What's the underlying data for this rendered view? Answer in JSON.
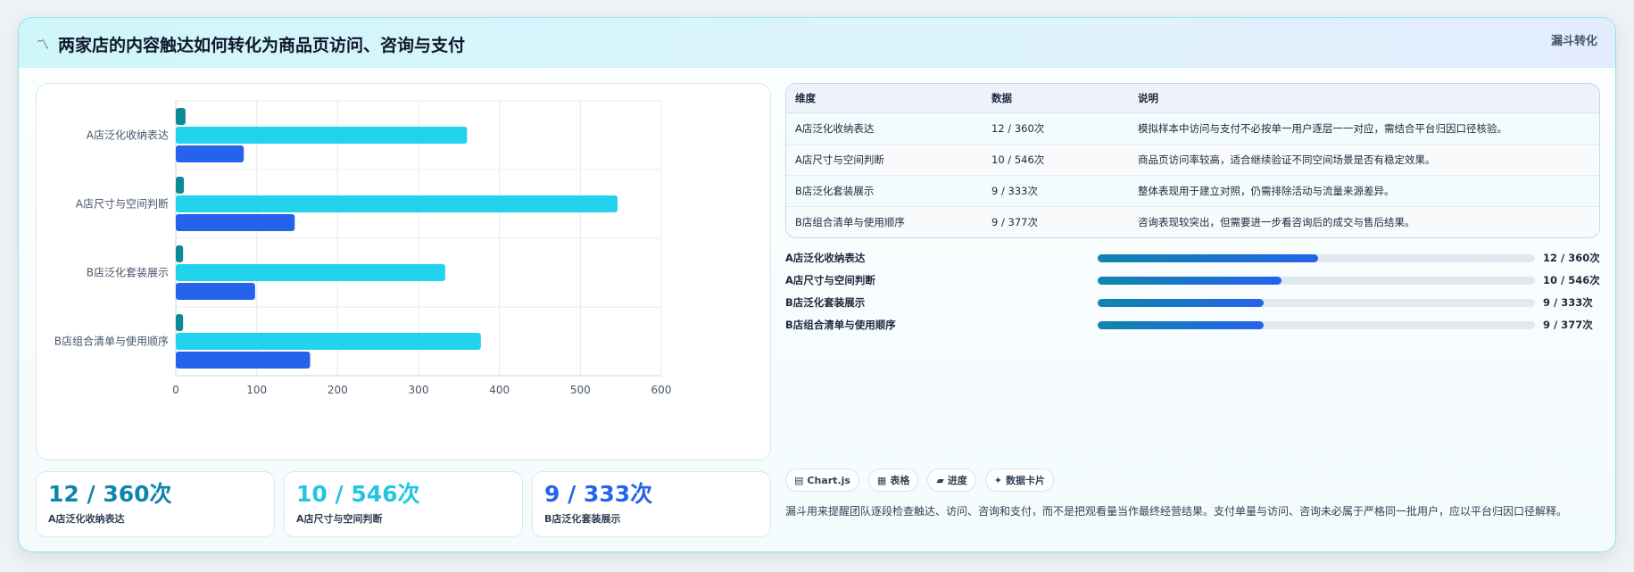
{
  "header": {
    "title": "两家店的内容触达如何转化为商品页访问、咨询与支付",
    "tag": "漏斗转化"
  },
  "colors": {
    "series_dark": "#0e8a94",
    "series_cyan": "#22d3ee",
    "series_blue": "#2563eb",
    "kpi_teal": "#0e86ab",
    "kpi_cyan": "#22c5e0",
    "kpi_blue": "#2563eb"
  },
  "chart_data": {
    "type": "bar",
    "orientation": "horizontal",
    "categories": [
      "A店泛化收纳表达",
      "A店尺寸与空间判断",
      "B店泛化套装展示",
      "B店组合清单与使用顺序"
    ],
    "series": [
      {
        "values": [
          12,
          10,
          9,
          9
        ],
        "color": "#0e8a94"
      },
      {
        "values": [
          360,
          546,
          333,
          377
        ],
        "color": "#22d3ee"
      },
      {
        "values": [
          84,
          147,
          98,
          166
        ],
        "color": "#2563eb"
      }
    ],
    "xlim": [
      0,
      600
    ],
    "xticks": [
      "0",
      "100",
      "200",
      "300",
      "400",
      "500",
      "600"
    ],
    "grid": true,
    "legend": "none"
  },
  "kpis": [
    {
      "value": "12 / 360次",
      "label": "A店泛化收纳表达",
      "color": "#0e86ab"
    },
    {
      "value": "10 / 546次",
      "label": "A店尺寸与空间判断",
      "color": "#22c5e0"
    },
    {
      "value": "9 / 333次",
      "label": "B店泛化套装展示",
      "color": "#2563eb"
    }
  ],
  "table": {
    "headers": [
      "维度",
      "数据",
      "说明"
    ],
    "rows": [
      [
        "A店泛化收纳表达",
        "12 / 360次",
        "模拟样本中访问与支付不必按单一用户逐层一一对应，需结合平台归因口径核验。"
      ],
      [
        "A店尺寸与空间判断",
        "10 / 546次",
        "商品页访问率较高，适合继续验证不同空间场景是否有稳定效果。"
      ],
      [
        "B店泛化套装展示",
        "9 / 333次",
        "整体表现用于建立对照，仍需排除活动与流量来源差异。"
      ],
      [
        "B店组合清单与使用顺序",
        "9 / 377次",
        "咨询表现较突出，但需要进一步看咨询后的成交与售后结果。"
      ]
    ]
  },
  "progress": [
    {
      "label": "A店泛化收纳表达",
      "value": "12 / 360次",
      "fraction": 0.505
    },
    {
      "label": "A店尺寸与空间判断",
      "value": "10 / 546次",
      "fraction": 0.42
    },
    {
      "label": "B店泛化套装展示",
      "value": "9 / 333次",
      "fraction": 0.379
    },
    {
      "label": "B店组合清单与使用顺序",
      "value": "9 / 377次",
      "fraction": 0.379
    }
  ],
  "chips": [
    {
      "icon": "▤",
      "label": "Chart.js"
    },
    {
      "icon": "▦",
      "label": "表格"
    },
    {
      "icon": "▰",
      "label": "进度"
    },
    {
      "icon": "✦",
      "label": "数据卡片"
    }
  ],
  "note": "漏斗用来提醒团队逐段检查触达、访问、咨询和支付，而不是把观看量当作最终经营结果。支付单量与访问、咨询未必属于严格同一批用户，应以平台归因口径解释。"
}
